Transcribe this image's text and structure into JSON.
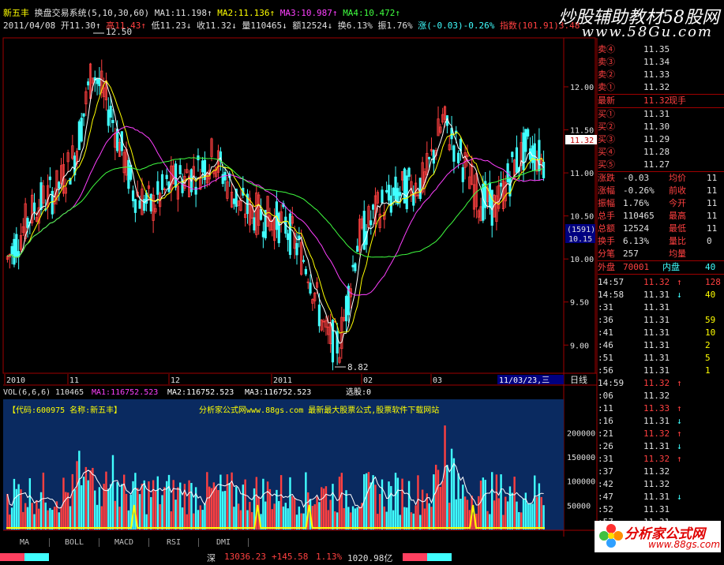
{
  "header": {
    "stock_name": "新五丰",
    "system": "换盘交易系统(5,10,30,60)",
    "ma1": "MA1:11.198↑",
    "ma2": "MA2:11.136↑",
    "ma3": "MA3:10.987↑",
    "ma4": "MA4:10.472↑",
    "date": "2011/04/08",
    "open": "开11.30↑",
    "high": "高11.43↑",
    "low": "低11.23↓",
    "close": "收11.32↓",
    "volume": "量110465↓",
    "amount": "额12524↓",
    "turnover": "换6.13%",
    "amplitude": "振1.76%",
    "change": "涨(-0.03)-0.26%",
    "index": "指数(101.91)3.48"
  },
  "watermark": {
    "line1": "炒股辅助教材58股网",
    "line2": "www.58Gu.com"
  },
  "price_axis": {
    "ticks": [
      "12.00",
      "11.50",
      "11.00",
      "10.50",
      "10.00",
      "9.50",
      "9.00"
    ],
    "current": "11.32",
    "mark1": "(1591)",
    "mark2": "10.15"
  },
  "annotations": {
    "high": "12.50",
    "low": "8.82"
  },
  "date_axis": {
    "labels": [
      "2010",
      "11",
      "12",
      "2011",
      "02",
      "03"
    ],
    "cursor": "11/03/23,三",
    "period": "日线"
  },
  "vol_header": {
    "vol": "VOL(6,6,6)",
    "value": "110465",
    "ma1": "MA1:116752.523",
    "ma2": "MA2:116752.523",
    "ma3": "MA3:116752.523",
    "pick": "选股:0"
  },
  "vol_banner": {
    "code": "【代码:600975 名称:新五丰】",
    "site": "分析家公式网www.88gs.com 最新最大股票公式,股票软件下载网站"
  },
  "vol_axis": {
    "ticks": [
      "200000",
      "150000",
      "100000",
      "50000"
    ]
  },
  "tabs": [
    "MA",
    "BOLL",
    "MACD",
    "RSI",
    "DMI"
  ],
  "quote": {
    "asks": [
      {
        "label": "卖④",
        "price": "11.35"
      },
      {
        "label": "卖③",
        "price": "11.34"
      },
      {
        "label": "卖②",
        "price": "11.33"
      },
      {
        "label": "卖①",
        "price": "11.32"
      }
    ],
    "last": {
      "label": "最新",
      "price": "11.32",
      "note": "现手"
    },
    "bids": [
      {
        "label": "买①",
        "price": "11.31"
      },
      {
        "label": "买②",
        "price": "11.30"
      },
      {
        "label": "买③",
        "price": "11.29"
      },
      {
        "label": "买④",
        "price": "11.28"
      },
      {
        "label": "买⑤",
        "price": "11.27"
      }
    ],
    "stats": [
      {
        "l1": "涨跌",
        "v1": "-0.03",
        "l2": "均价",
        "v2": "11"
      },
      {
        "l1": "涨幅",
        "v1": "-0.26%",
        "l2": "前收",
        "v2": "11"
      },
      {
        "l1": "振幅",
        "v1": "1.76%",
        "l2": "今开",
        "v2": "11"
      },
      {
        "l1": "总手",
        "v1": "110465",
        "l2": "最高",
        "v2": "11"
      },
      {
        "l1": "总额",
        "v1": "12524",
        "l2": "最低",
        "v2": "11"
      },
      {
        "l1": "换手",
        "v1": "6.13%",
        "l2": "量比",
        "v2": "0"
      },
      {
        "l1": "分笔",
        "v1": "257",
        "l2": "均量",
        "v2": ""
      }
    ],
    "outer": {
      "l1": "外盘",
      "v1": "70001",
      "l2": "内盘",
      "v2": "40"
    }
  },
  "ticks": [
    {
      "t": "14:57",
      "p": "11.32",
      "a": "↑",
      "v": "128"
    },
    {
      "t": "14:58",
      "p": "11.31",
      "a": "↓",
      "v": "40"
    },
    {
      "t": ":31",
      "p": "11.31",
      "a": "",
      "v": ""
    },
    {
      "t": ":36",
      "p": "11.31",
      "a": "",
      "v": "59"
    },
    {
      "t": ":41",
      "p": "11.31",
      "a": "",
      "v": "10"
    },
    {
      "t": ":46",
      "p": "11.31",
      "a": "",
      "v": "2"
    },
    {
      "t": ":51",
      "p": "11.31",
      "a": "",
      "v": "5"
    },
    {
      "t": ":56",
      "p": "11.31",
      "a": "",
      "v": "1"
    },
    {
      "t": "14:59",
      "p": "11.32",
      "a": "↑",
      "v": ""
    },
    {
      "t": ":06",
      "p": "11.32",
      "a": "",
      "v": ""
    },
    {
      "t": ":11",
      "p": "11.33",
      "a": "↑",
      "v": ""
    },
    {
      "t": ":16",
      "p": "11.31",
      "a": "↓",
      "v": ""
    },
    {
      "t": ":21",
      "p": "11.32",
      "a": "↑",
      "v": ""
    },
    {
      "t": ":26",
      "p": "11.31",
      "a": "↓",
      "v": ""
    },
    {
      "t": ":31",
      "p": "11.32",
      "a": "↑",
      "v": ""
    },
    {
      "t": ":37",
      "p": "11.32",
      "a": "",
      "v": ""
    },
    {
      "t": ":42",
      "p": "11.32",
      "a": "",
      "v": ""
    },
    {
      "t": ":47",
      "p": "11.31",
      "a": "↓",
      "v": ""
    },
    {
      "t": ":52",
      "p": "11.31",
      "a": "",
      "v": ""
    },
    {
      "t": ":57",
      "p": "11.31",
      "a": "",
      "v": ""
    }
  ],
  "status": {
    "market": "深",
    "index": "13036.23",
    "change": "+145.58",
    "pct": "1.13%",
    "amount": "1020.98亿"
  },
  "logo": {
    "name": "分析家公式网",
    "url": "www.88gs.com"
  },
  "colors": {
    "up": "#ff4040",
    "down": "#40ffff",
    "ma1": "#ffffff",
    "ma2": "#ffff00",
    "ma3": "#ff40ff",
    "ma4": "#40ff40",
    "grid": "#a00000",
    "volbg": "#0a2a60"
  }
}
